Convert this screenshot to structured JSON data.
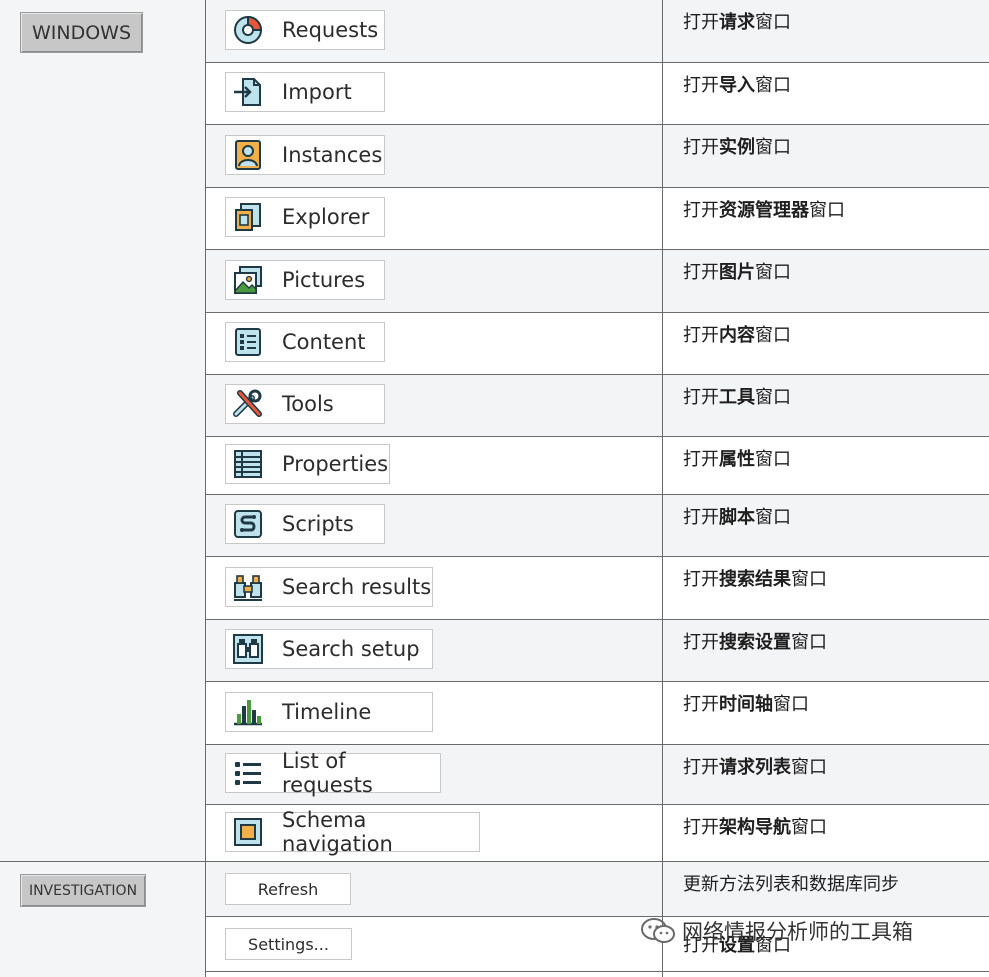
{
  "sections": {
    "windows_label": "WINDOWS",
    "investigation_label": "INVESTIGATION"
  },
  "windows_rows": [
    {
      "label": "Requests",
      "icon": "requests-icon",
      "desc_pre": "打开",
      "desc_bold": "请求",
      "desc_post": "窗口"
    },
    {
      "label": "Import",
      "icon": "import-icon",
      "desc_pre": "打开",
      "desc_bold": "导入",
      "desc_post": "窗口"
    },
    {
      "label": "Instances",
      "icon": "instances-icon",
      "desc_pre": "打开",
      "desc_bold": "实例",
      "desc_post": "窗口"
    },
    {
      "label": "Explorer",
      "icon": "explorer-icon",
      "desc_pre": "打开",
      "desc_bold": "资源管理器",
      "desc_post": "窗口"
    },
    {
      "label": "Pictures",
      "icon": "pictures-icon",
      "desc_pre": "打开",
      "desc_bold": "图片",
      "desc_post": "窗口"
    },
    {
      "label": "Content",
      "icon": "content-icon",
      "desc_pre": "打开",
      "desc_bold": "内容",
      "desc_post": "窗口"
    },
    {
      "label": "Tools",
      "icon": "tools-icon",
      "desc_pre": "打开",
      "desc_bold": "工具",
      "desc_post": "窗口"
    },
    {
      "label": "Properties",
      "icon": "properties-icon",
      "desc_pre": "打开",
      "desc_bold": "属性",
      "desc_post": "窗口"
    },
    {
      "label": "Scripts",
      "icon": "scripts-icon",
      "desc_pre": "打开",
      "desc_bold": "脚本",
      "desc_post": "窗口"
    },
    {
      "label": "Search results",
      "icon": "search-results-icon",
      "desc_pre": "打开",
      "desc_bold": "搜索结果",
      "desc_post": "窗口"
    },
    {
      "label": "Search setup",
      "icon": "search-setup-icon",
      "desc_pre": "打开",
      "desc_bold": "搜索设置",
      "desc_post": "窗口"
    },
    {
      "label": "Timeline",
      "icon": "timeline-icon",
      "desc_pre": "打开",
      "desc_bold": "时间轴",
      "desc_post": "窗口"
    },
    {
      "label": "List of requests",
      "icon": "list-of-requests-icon",
      "desc_pre": "打开",
      "desc_bold": "请求列表",
      "desc_post": "窗口"
    },
    {
      "label": "Schema navigation",
      "icon": "schema-navigation-icon",
      "desc_pre": "打开",
      "desc_bold": "架构导航",
      "desc_post": "窗口"
    }
  ],
  "investigation_rows": [
    {
      "label": "Refresh",
      "desc": "更新方法列表和数据库同步"
    },
    {
      "label": "Settings...",
      "desc_pre": "打开",
      "desc_bold": "设置",
      "desc_post": "窗口"
    }
  ],
  "watermark": {
    "text": "网络情报分析师的工具箱",
    "icon": "wechat-icon"
  }
}
